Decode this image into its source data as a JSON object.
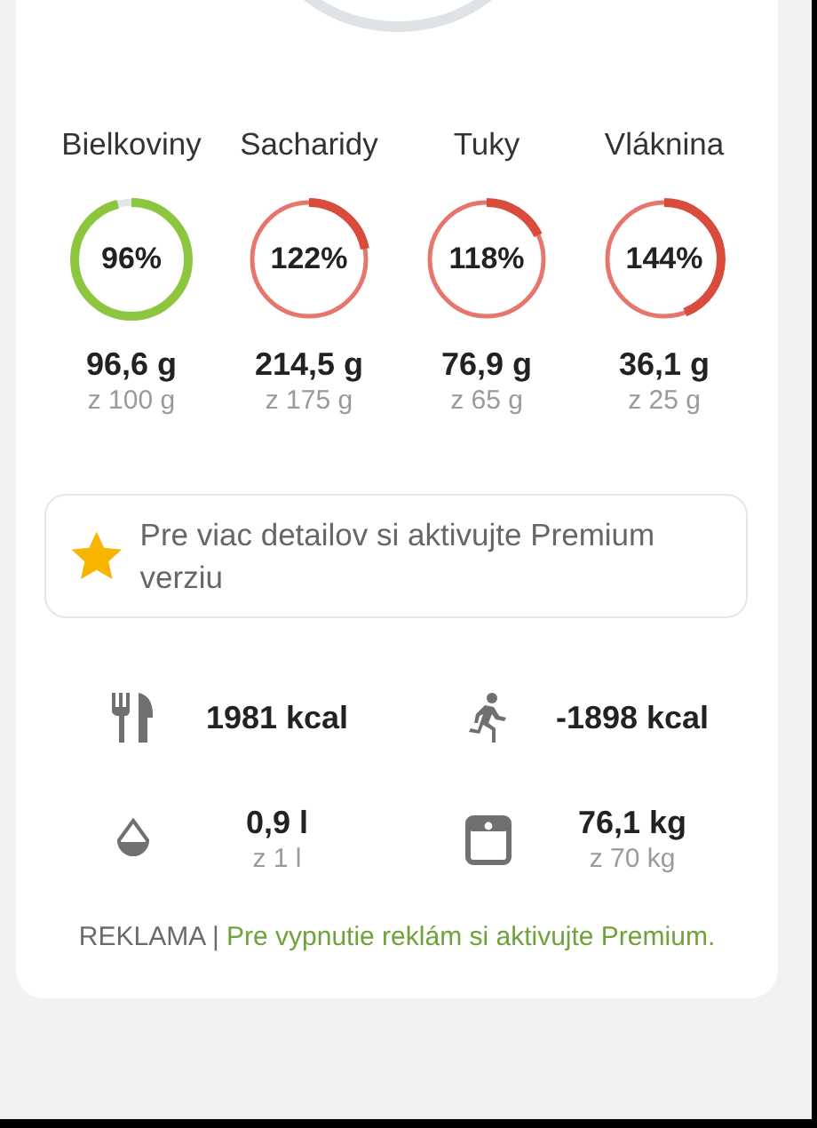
{
  "macros": [
    {
      "label": "Bielkoviny",
      "percent": "96%",
      "level": 0.96,
      "over": false,
      "amount": "96,6 g",
      "goal": "z 100 g"
    },
    {
      "label": "Sacharidy",
      "percent": "122%",
      "level": 0.22,
      "over": true,
      "amount": "214,5 g",
      "goal": "z 175 g"
    },
    {
      "label": "Tuky",
      "percent": "118%",
      "level": 0.18,
      "over": true,
      "amount": "76,9 g",
      "goal": "z 65 g"
    },
    {
      "label": "Vláknina",
      "percent": "144%",
      "level": 0.44,
      "over": true,
      "amount": "36,1 g",
      "goal": "z 25 g"
    }
  ],
  "premium_banner": {
    "text": "Pre viac detailov si aktivujte Premium verziu"
  },
  "stats": [
    {
      "kind": "food",
      "value": "1981 kcal"
    },
    {
      "kind": "exercise",
      "value": "-1898 kcal"
    },
    {
      "kind": "water",
      "value": "0,9 l",
      "goal": "z 1 l"
    },
    {
      "kind": "weight",
      "value": "76,1 kg",
      "goal": "z 70 kg"
    }
  ],
  "footer": {
    "label": "REKLAMA",
    "separator": "|",
    "link": "Pre vypnutie reklám si aktivujte Premium."
  }
}
